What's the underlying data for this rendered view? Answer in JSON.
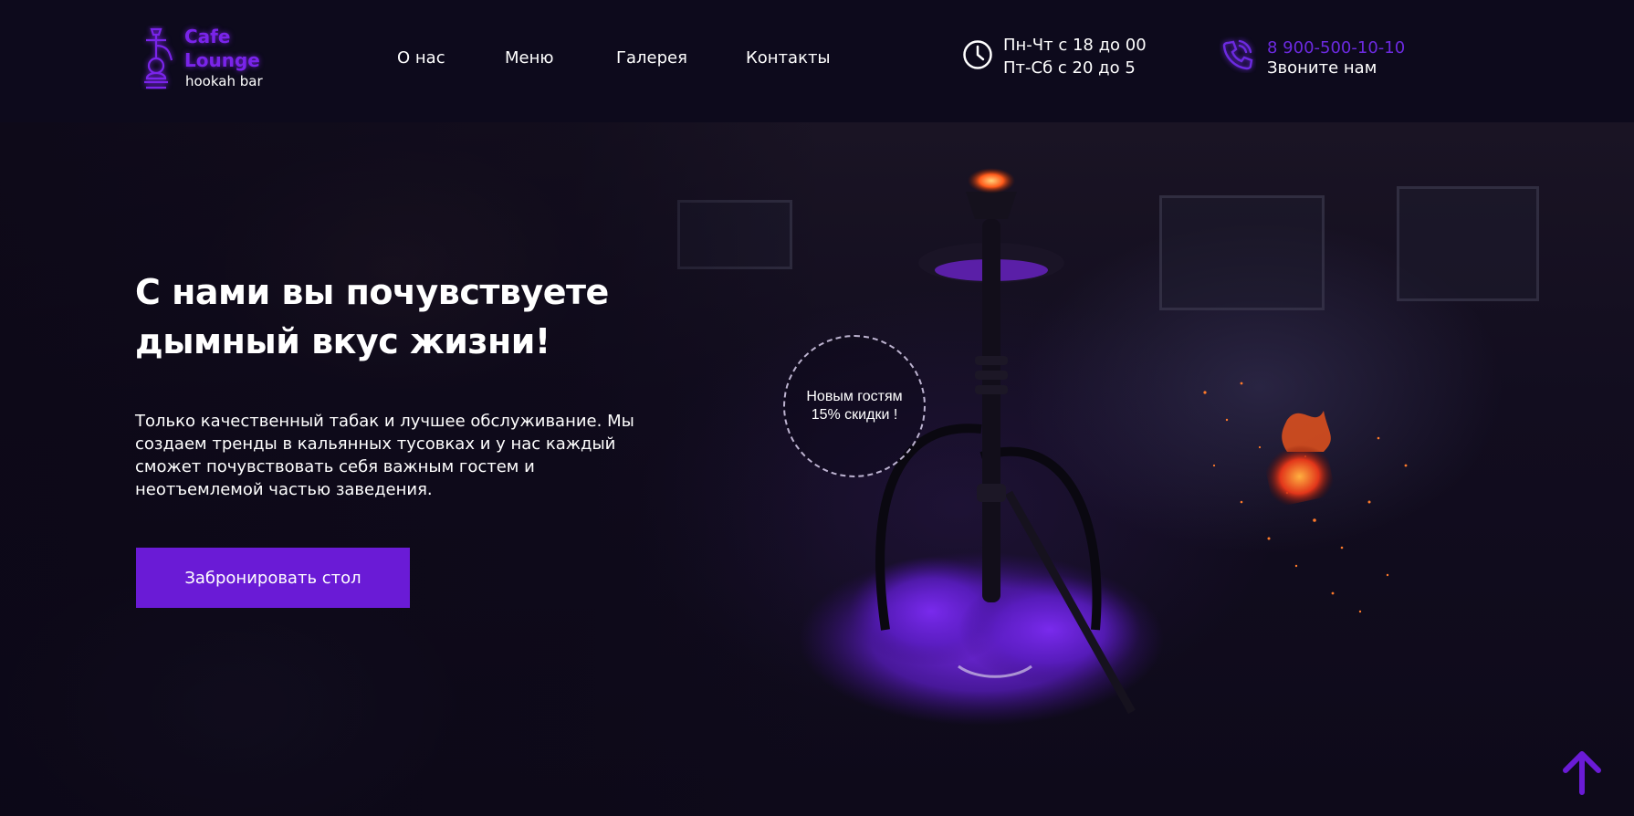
{
  "logo": {
    "line1": "Cafe",
    "line2": "Lounge",
    "subtitle": "hookah bar",
    "icon": "hookah-icon",
    "accent": "#7a24ea"
  },
  "nav": {
    "items": [
      {
        "label": "О нас"
      },
      {
        "label": "Меню"
      },
      {
        "label": "Галерея"
      },
      {
        "label": "Контакты"
      }
    ]
  },
  "hours": {
    "icon": "clock-icon",
    "line1": "Пн-Чт с 18 до 00",
    "line2": "Пт-Сб с 20 до 5"
  },
  "contact": {
    "icon": "phone-icon",
    "phone": "8 900-500-10-10",
    "label": "Звоните нам",
    "phone_color": "#6c2ae0"
  },
  "hero": {
    "title_line1": "С нами вы почувствуете",
    "title_line2": "дымный вкус жизни!",
    "description": "Только качественный табак и лучшее обслуживание. Мы создаем тренды в кальянных тусовках и у нас каждый сможет почувствовать себя важным гостем и неотъемлемой частью заведения.",
    "button_label": "Забронировать стол",
    "button_color": "#6a1bd6"
  },
  "discount": {
    "line1": "Новым гостям",
    "line2": "15% скидки !"
  },
  "scroll_top": {
    "icon": "arrow-up-icon",
    "color": "#6a1bd6"
  }
}
